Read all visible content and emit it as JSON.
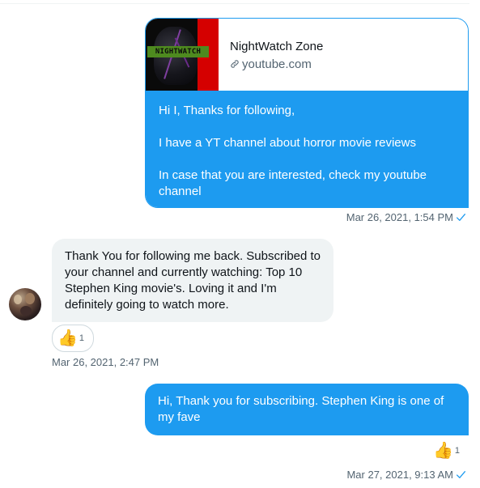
{
  "messages": {
    "outgoing_card": {
      "thumbnail_text": "NIGHTWATCH",
      "card_title": "NightWatch Zone",
      "card_domain": "youtube.com",
      "lines": [
        "Hi I, Thanks for following,",
        "I have a YT channel about horror movie reviews",
        "In case that you are interested, check my youtube channel"
      ],
      "timestamp": "Mar 26, 2021, 1:54 PM"
    },
    "incoming": {
      "text": "Thank You for following me back. Subscribed to your channel and currently watching: Top 10 Stephen King movie's. Loving it and I'm definitely going to watch more.",
      "reaction_emoji": "👍",
      "reaction_count": "1",
      "timestamp": "Mar 26, 2021, 2:47 PM"
    },
    "outgoing_reply": {
      "text": "Hi, Thank you for subscribing. Stephen King is one of my fave",
      "reaction_emoji": "👍",
      "reaction_count": "1",
      "timestamp": "Mar 27, 2021, 9:13 AM"
    }
  },
  "icons": {
    "link": "link-icon",
    "sent": "check-icon"
  },
  "colors": {
    "accent": "#1d9bf0",
    "incoming_bg": "#eff3f4",
    "meta_text": "#536471"
  }
}
